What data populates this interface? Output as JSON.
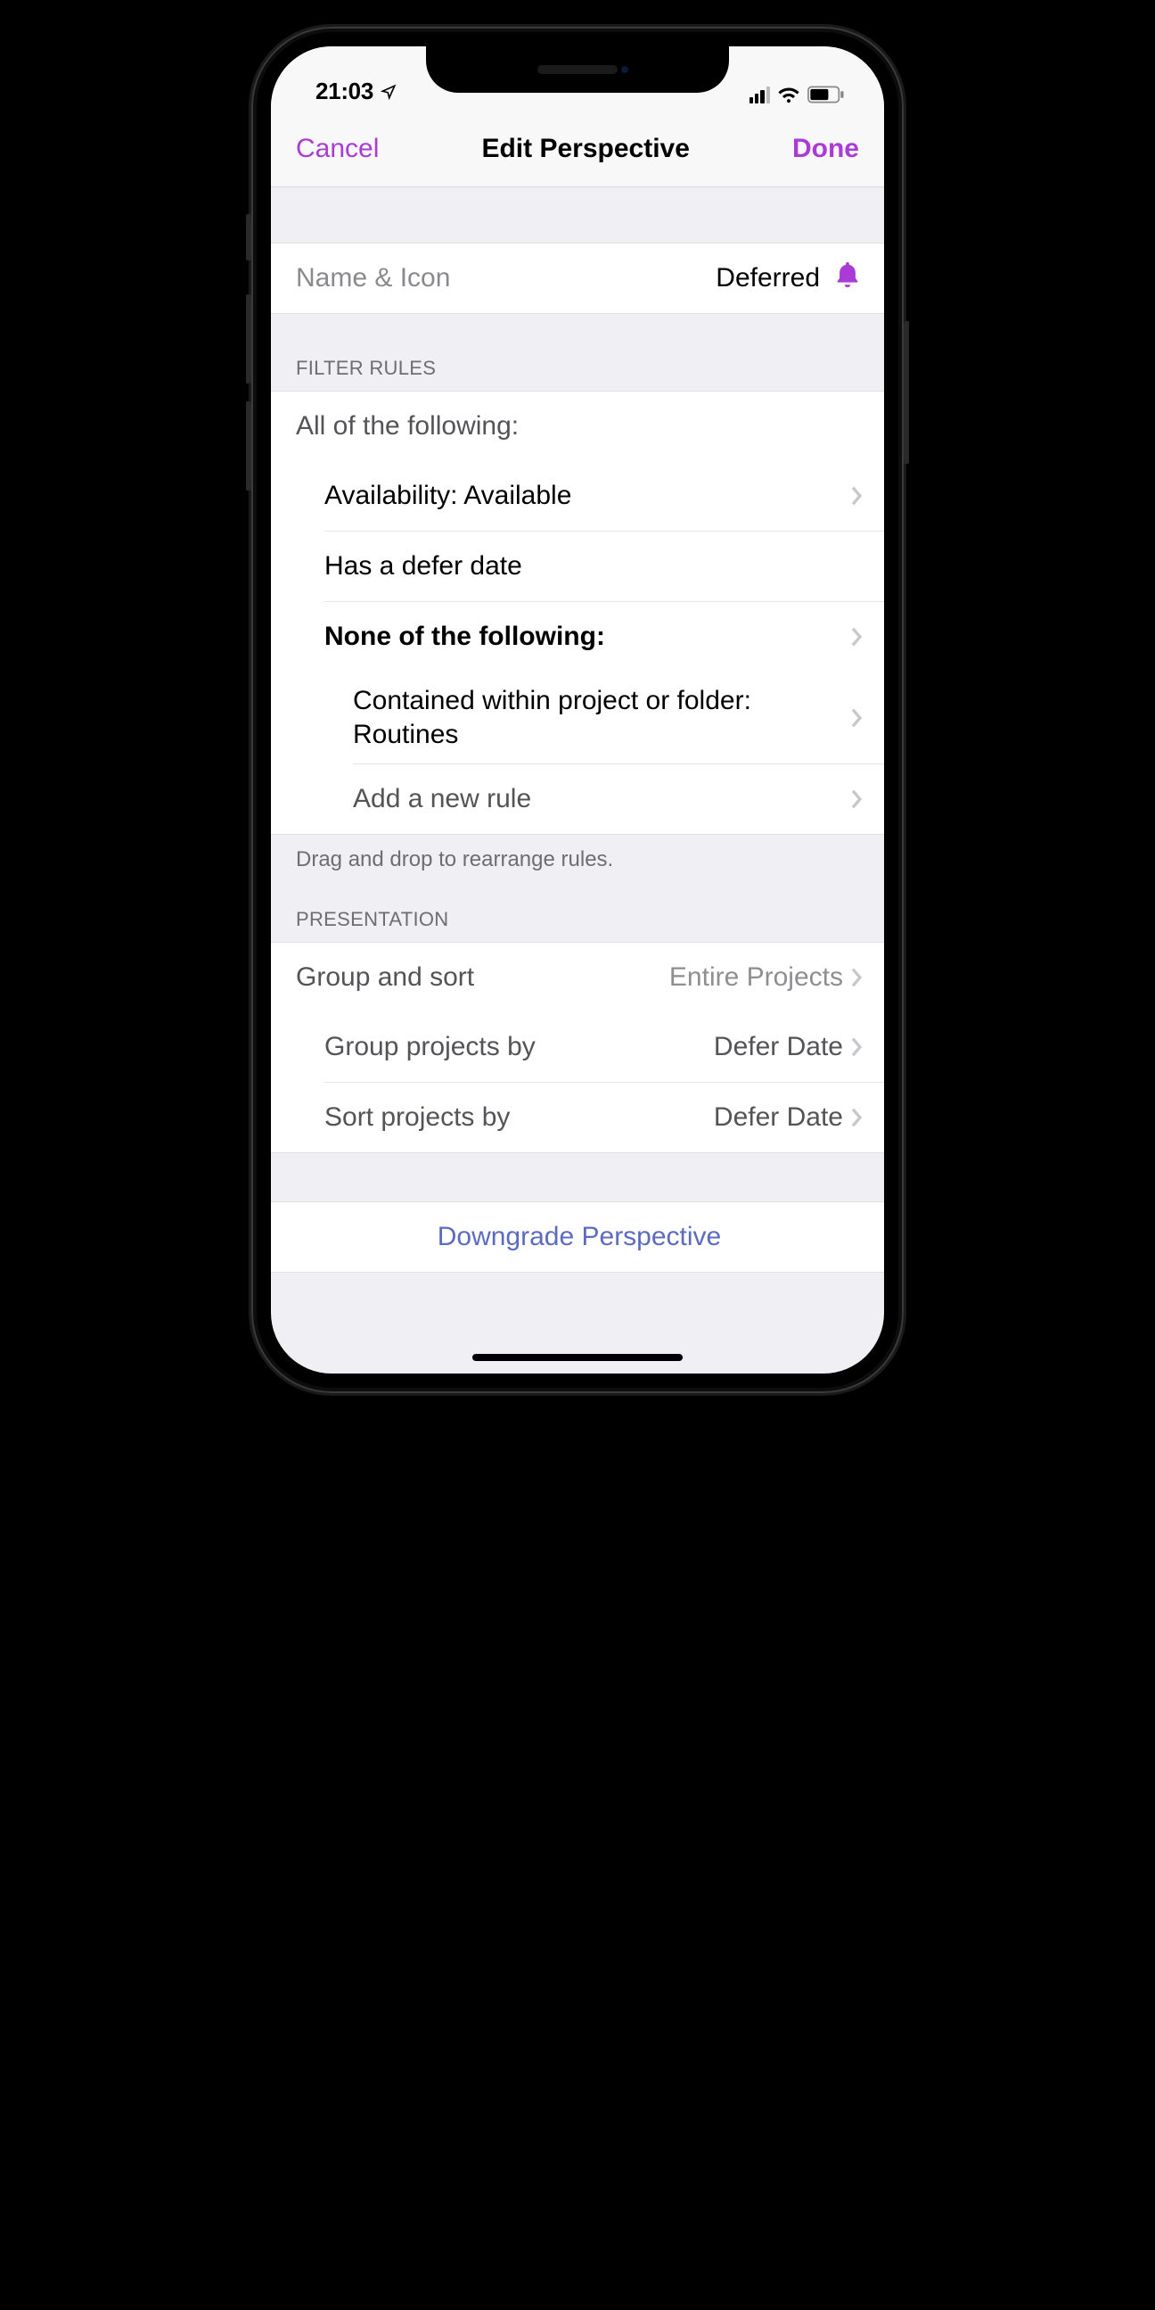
{
  "status": {
    "time": "21:03"
  },
  "nav": {
    "cancel": "Cancel",
    "title": "Edit Perspective",
    "done": "Done"
  },
  "name_icon": {
    "label": "Name & Icon",
    "value": "Deferred",
    "icon": "bell"
  },
  "sections": {
    "filter_header": "FILTER RULES",
    "filter_footer": "Drag and drop to rearrange rules.",
    "presentation_header": "PRESENTATION"
  },
  "rules": {
    "group_label": "All of the following:",
    "items": [
      {
        "text": "Availability: Available",
        "chevron": true
      },
      {
        "text": "Has a defer date",
        "chevron": false
      }
    ],
    "nested": {
      "label": "None of the following:",
      "items": [
        {
          "text": "Contained within project or folder: Routines",
          "chevron": true
        }
      ],
      "add_label": "Add a new rule"
    }
  },
  "presentation": {
    "group_sort": {
      "label": "Group and sort",
      "value": "Entire Projects"
    },
    "group_by": {
      "label": "Group projects by",
      "value": "Defer Date"
    },
    "sort_by": {
      "label": "Sort projects by",
      "value": "Defer Date"
    }
  },
  "downgrade": "Downgrade Perspective"
}
